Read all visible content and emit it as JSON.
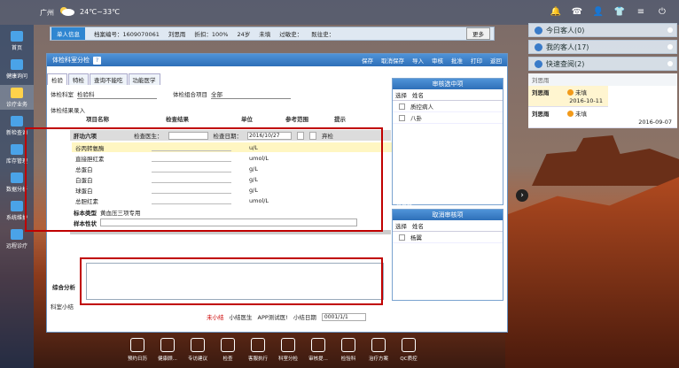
{
  "topbar": {
    "city": "广州",
    "temp": "24℃~33℃"
  },
  "sidebar": [
    {
      "label": "首页"
    },
    {
      "label": "健康询问"
    },
    {
      "label": "诊疗业务"
    },
    {
      "label": "新检查询"
    },
    {
      "label": "库存管理"
    },
    {
      "label": "数据分析"
    },
    {
      "label": "系统维护"
    },
    {
      "label": "远程诊疗"
    }
  ],
  "infobar": {
    "tag": "单人信息",
    "archive": "档案编号：1609070061",
    "name": "刘思雨",
    "discount": "折扣：100%",
    "age": "24岁",
    "status": "未填",
    "allergy": "过敏史：",
    "history": "既往史：",
    "more": "更多"
  },
  "panel": {
    "title": "体检科室分检",
    "help": "?",
    "tools": [
      "保存",
      "取消保存",
      "导入",
      "审核",
      "批准",
      "打印",
      "返回"
    ],
    "tabs": [
      "检验",
      "特检",
      "查询不能吃",
      "功能医学"
    ],
    "dept_label": "体检科室",
    "dept_value": "检验科",
    "group_label": "体检组合项目",
    "group_value": "全部",
    "result_entry": "体检结果录入",
    "cols": [
      "项目名称",
      "检查结果",
      "单位",
      "参考范围",
      "提示"
    ],
    "section": "肝功六项",
    "doctor_label": "检查医生：",
    "date_label": "检查日期：",
    "date_value": "2016/10/27",
    "abandon": "弃检",
    "items": [
      {
        "name": "谷丙转氨酶",
        "unit": "u/L"
      },
      {
        "name": "直接胆红素",
        "unit": "umol/L"
      },
      {
        "name": "总蛋白",
        "unit": "g/L"
      },
      {
        "name": "白蛋白",
        "unit": "g/L"
      },
      {
        "name": "球蛋白",
        "unit": "g/L"
      },
      {
        "name": "总胆红素",
        "unit": "umol/L"
      }
    ],
    "sample_type": "标本类型",
    "sample_value": "黄血压三项专用",
    "sample_traits": "样本性状",
    "summary": "科室小结",
    "analysis": "综合分析",
    "foot": {
      "summary_note": "未小结",
      "doc": "小结医生",
      "app": "APP测试医!",
      "date_label": "小结日期",
      "date": "0001/1/1"
    }
  },
  "checklist_pending": {
    "tag": "未审核",
    "header": "审核选中项",
    "cols": [
      "选择",
      "姓名"
    ],
    "rows": [
      "质控病人",
      "八卦"
    ]
  },
  "checklist_done": {
    "tag": "已审核",
    "header": "取消审核项",
    "cols": [
      "选择",
      "姓名"
    ],
    "rows": [
      "杨翼"
    ]
  },
  "right": {
    "today": "今日客人(0)",
    "mine": "我的客人(17)",
    "quick": "快速查阅(2)",
    "search_name": "刘思雨",
    "entries": [
      {
        "name": "刘思雨",
        "status": "未填",
        "date": "2016-10-11"
      },
      {
        "name": "刘思雨",
        "status": "未填",
        "date": "2016-09-07"
      }
    ]
  },
  "dock": [
    "预约日历",
    "健康顾...",
    "专访建议",
    "检查",
    "客服执行",
    "科室分检",
    "审核提...",
    "检验科",
    "治疗方案",
    "QC质控"
  ]
}
